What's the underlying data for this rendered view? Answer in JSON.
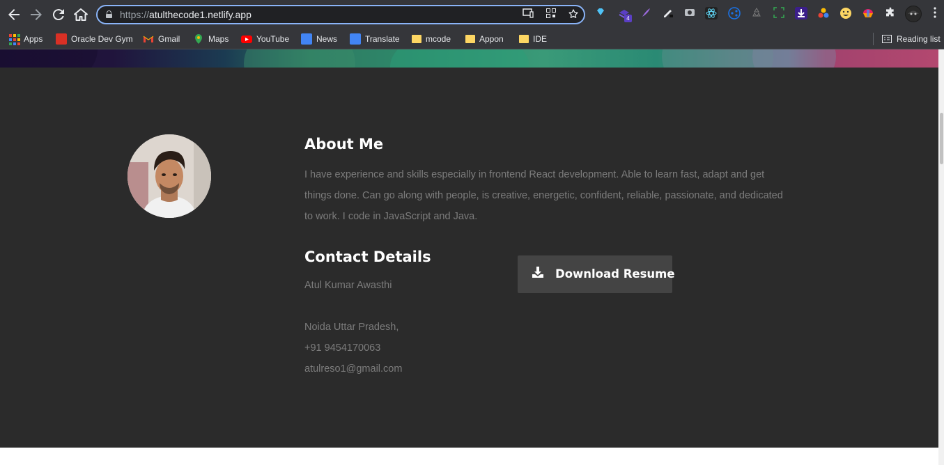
{
  "browser": {
    "url_protocol": "https://",
    "url_host": "atulthecode1.netlify.app",
    "nav": {
      "back_icon": "back-arrow-icon",
      "forward_icon": "forward-arrow-icon",
      "reload_icon": "reload-icon",
      "home_icon": "home-icon"
    },
    "extension_badge": "4",
    "bookmarks": [
      {
        "label": "Apps",
        "icon": "apps-grid-icon"
      },
      {
        "label": "Oracle Dev Gym",
        "icon": "oracle-icon"
      },
      {
        "label": "Gmail",
        "icon": "gmail-icon"
      },
      {
        "label": "Maps",
        "icon": "maps-icon"
      },
      {
        "label": "YouTube",
        "icon": "youtube-icon"
      },
      {
        "label": "News",
        "icon": "news-icon"
      },
      {
        "label": "Translate",
        "icon": "translate-icon"
      },
      {
        "label": "mcode",
        "icon": "folder-icon"
      },
      {
        "label": "Appon",
        "icon": "folder-icon"
      },
      {
        "label": "IDE",
        "icon": "folder-icon"
      }
    ],
    "reading_list": "Reading list"
  },
  "about": {
    "heading": "About Me",
    "text": "I have experience and skills especially in frontend React development. Able to learn fast, adapt and get things done. Can go along with people, is creative, energetic, confident, reliable, passionate, and dedicated to work. I code in JavaScript and Java."
  },
  "contact": {
    "heading": "Contact Details",
    "name": "Atul Kumar Awasthi",
    "address": "Noida Uttar Pradesh,",
    "phone": "+91 9454170063",
    "email": "atulreso1@gmail.com"
  },
  "resume": {
    "button_label": "Download Resume",
    "icon": "download-icon"
  },
  "colors": {
    "section_bg": "#2b2b2b",
    "heading": "#ffffff",
    "body_text": "#7c7c7c",
    "button_bg": "#444444",
    "omnibox_focus": "#8ab4f8"
  }
}
